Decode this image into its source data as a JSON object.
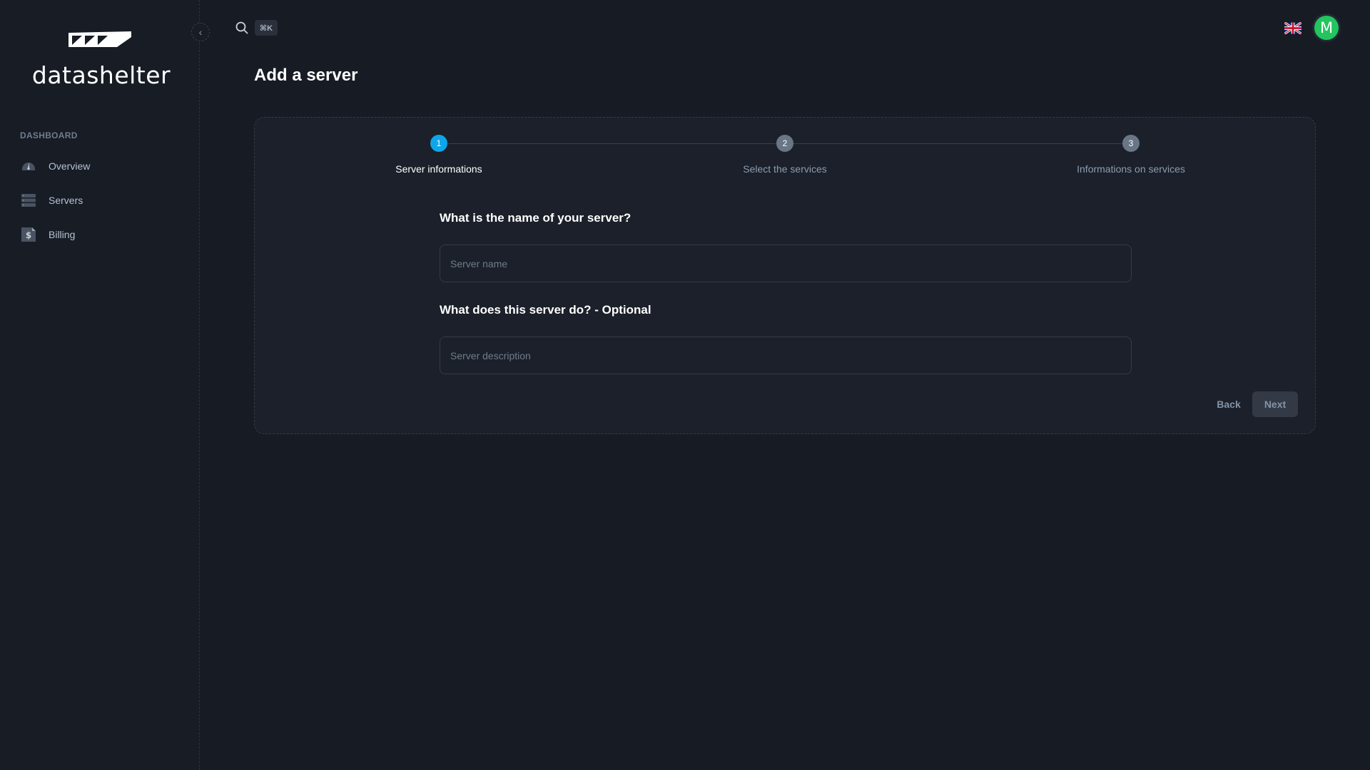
{
  "app": {
    "brand_name": "datashelter"
  },
  "sidebar": {
    "section_label": "DASHBOARD",
    "collapse_icon": "chevron-left-icon",
    "items": [
      {
        "label": "Overview",
        "icon": "gauge-icon"
      },
      {
        "label": "Servers",
        "icon": "server-stack-icon"
      },
      {
        "label": "Billing",
        "icon": "invoice-dollar-icon"
      }
    ]
  },
  "topbar": {
    "search_icon": "search-icon",
    "shortcut": "⌘K",
    "language_flag": "uk-flag-icon",
    "avatar_initial": "M",
    "avatar_color": "#22c55e"
  },
  "page": {
    "title": "Add a server"
  },
  "wizard": {
    "current_step": 1,
    "steps": [
      {
        "number": "1",
        "label": "Server informations",
        "state": "active"
      },
      {
        "number": "2",
        "label": "Select the services",
        "state": "inactive"
      },
      {
        "number": "3",
        "label": "Informations on services",
        "state": "inactive"
      }
    ],
    "accent_color": "#0ea5e9",
    "form": {
      "name_question": "What is the name of your server?",
      "name_value": "",
      "name_placeholder": "Server name",
      "description_question": "What does this server do? - Optional",
      "description_value": "",
      "description_placeholder": "Server description"
    },
    "back_label": "Back",
    "next_label": "Next"
  }
}
